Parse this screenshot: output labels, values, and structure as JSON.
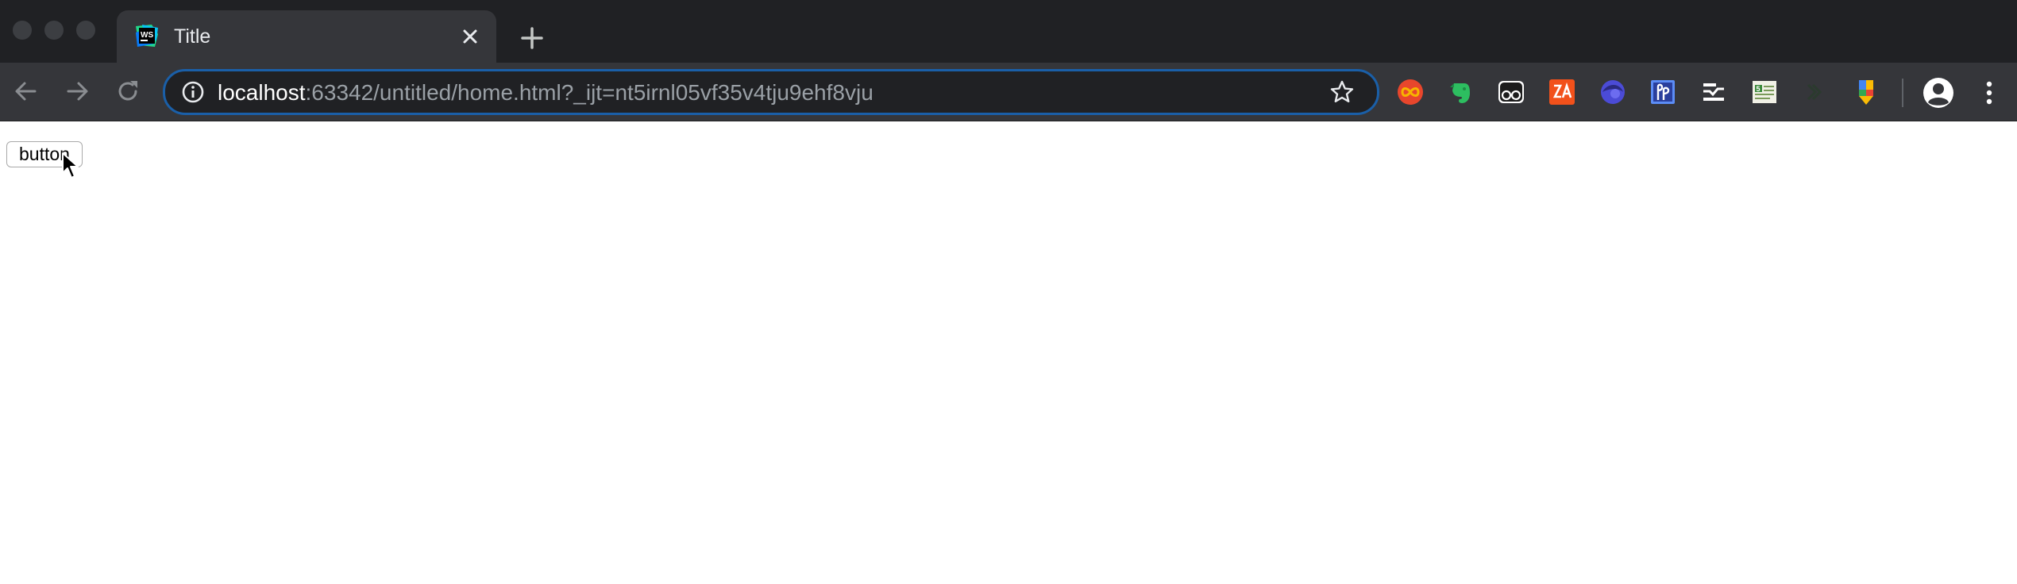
{
  "window": {
    "traffic_lights": [
      "close",
      "minimize",
      "maximize"
    ]
  },
  "tab": {
    "title": "Title",
    "favicon": "webstorm-icon",
    "close_icon": "close-icon"
  },
  "toolbar": {
    "back_icon": "arrow-back-icon",
    "forward_icon": "arrow-forward-icon",
    "reload_icon": "reload-icon",
    "new_tab_icon": "plus-icon"
  },
  "address_bar": {
    "host": "localhost",
    "rest": ":63342/untitled/home.html?_ijt=nt5irnl05vf35v4tju9ehf8vju",
    "info_icon": "info-icon",
    "bookmark_icon": "star-icon"
  },
  "extensions": [
    {
      "name": "infinity-extension-icon",
      "color": "#e8462c"
    },
    {
      "name": "evernote-extension-icon",
      "color": "#2dbe60"
    },
    {
      "name": "glasses-extension-icon",
      "color": "#ffffff"
    },
    {
      "name": "red-extension-icon",
      "color": "#f2511b"
    },
    {
      "name": "blue-orb-extension-icon",
      "color": "#4b4bd6"
    },
    {
      "name": "blue-square-extension-icon",
      "color": "#5c8df6"
    },
    {
      "name": "lines-extension-icon",
      "color": "#ffffff"
    },
    {
      "name": "sheet-extension-icon",
      "color": "#f1f1e6"
    },
    {
      "name": "dim-extension-icon",
      "color": "#2b3a2e"
    },
    {
      "name": "color-pin-extension-icon",
      "color": "#fbbc05"
    }
  ],
  "colors": {
    "tab_strip": "#202124",
    "toolbar": "#35363a",
    "omnibox_focus": "#1a5fa8"
  },
  "page": {
    "button_label": "button"
  }
}
